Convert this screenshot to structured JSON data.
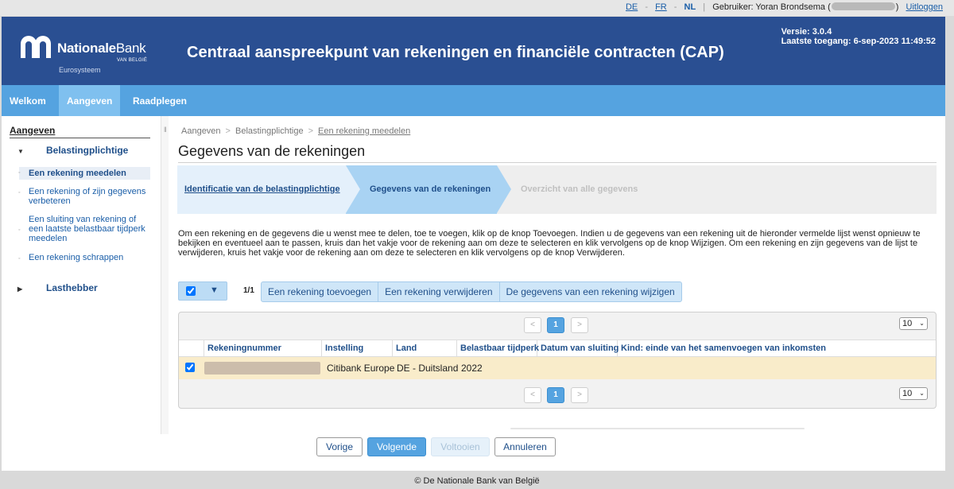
{
  "topbar": {
    "lang_de": "DE",
    "lang_fr": "FR",
    "lang_nl": "NL",
    "user_label": "Gebruiker: Yoran Brondsema (",
    "user_suffix": ")",
    "logout": "Uitloggen"
  },
  "header": {
    "logo_name_bold": "Nationale",
    "logo_name_light": "Bank",
    "logo_sub": "VAN BELGIË",
    "logo_euro": "Eurosysteem",
    "title": "Centraal aanspreekpunt van rekeningen en financiële contracten (CAP)",
    "version": "Versie: 3.0.4",
    "last_access": "Laatste toegang: 6-sep-2023 11:49:52"
  },
  "nav": {
    "items": [
      {
        "label": "Welkom"
      },
      {
        "label": "Aangeven",
        "active": true
      },
      {
        "label": "Raadplegen"
      }
    ]
  },
  "sidebar": {
    "heading": "Aangeven",
    "group1": "Belastingplichtige",
    "items": [
      {
        "label": "Een rekening meedelen",
        "selected": true
      },
      {
        "label": "Een rekening of zijn gegevens verbeteren"
      },
      {
        "label": "Een sluiting van rekening of een laatste belastbaar tijdperk meedelen"
      },
      {
        "label": "Een rekening schrappen"
      }
    ],
    "group2": "Lasthebber"
  },
  "breadcrumb": {
    "c1": "Aangeven",
    "c2": "Belastingplichtige",
    "c3": "Een rekening meedelen"
  },
  "page_title": "Gegevens van de rekeningen",
  "steps": {
    "s1": "Identificatie van de belastingplichtige",
    "s2": "Gegevens van de rekeningen",
    "s3": "Overzicht van alle gegevens"
  },
  "instructions": "Om een rekening en de gegevens die u wenst mee te delen, toe te voegen, klik op de knop Toevoegen. Indien u de gegevens van een rekening uit de hieronder vermelde lijst wenst opnieuw te bekijken en eventueel aan te passen, kruis dan het vakje voor de rekening aan om deze te selecteren en klik vervolgens op de knop Wijzigen. Om een rekening en zijn gegevens van de lijst te verwijderen, kruis het vakje voor de rekening aan om deze te selecteren en klik vervolgens op de knop Verwijderen.",
  "toolbar": {
    "count": "1/1",
    "add": "Een rekening toevoegen",
    "remove": "Een rekening verwijderen",
    "edit": "De gegevens van een rekening wijzigen"
  },
  "grid": {
    "page_prev": "<",
    "page_current": "1",
    "page_next": ">",
    "page_size": "10",
    "columns": [
      "Rekeningnummer",
      "Instelling",
      "Land",
      "Belastbaar tijdperk",
      "Datum van sluiting",
      "Kind: einde van het samenvoegen van inkomsten"
    ],
    "rows": [
      {
        "instelling": "Citibank Europe",
        "land": "DE - Duitsland",
        "tijdperk": "2022",
        "sluiting": "",
        "kind": ""
      }
    ]
  },
  "actions": {
    "prev": "Vorige",
    "next": "Volgende",
    "finish": "Voltooien",
    "cancel": "Annuleren"
  },
  "footer": "© De Nationale Bank van België"
}
